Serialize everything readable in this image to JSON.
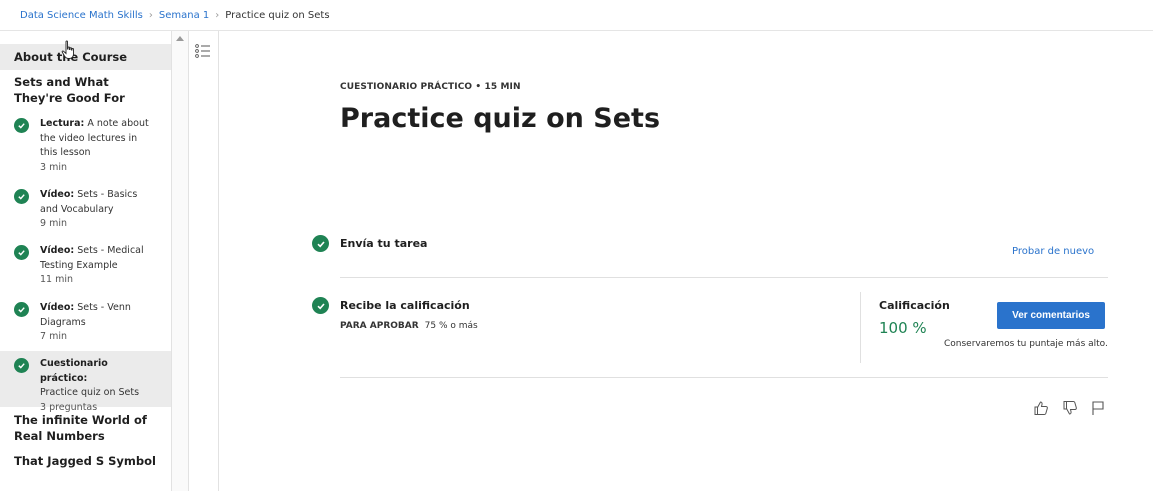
{
  "breadcrumb": {
    "course": "Data Science Math Skills",
    "week": "Semana 1",
    "current": "Practice quiz on Sets"
  },
  "sidebar": {
    "about": "About the Course",
    "module": "Sets and What They're Good For",
    "items": [
      {
        "type": "Lectura:",
        "title": "A note about the video lectures in this lesson",
        "meta": "3 min"
      },
      {
        "type": "Vídeo:",
        "title": "Sets - Basics and Vocabulary",
        "meta": "9 min"
      },
      {
        "type": "Vídeo:",
        "title": "Sets - Medical Testing Example",
        "meta": "11 min"
      },
      {
        "type": "Vídeo:",
        "title": "Sets - Venn Diagrams",
        "meta": "7 min"
      },
      {
        "type": "Cuestionario práctico:",
        "title": "Practice quiz on Sets",
        "meta": "3 preguntas"
      }
    ],
    "next_modules": [
      "The infinite World of Real Numbers",
      "That Jagged S Symbol"
    ]
  },
  "main": {
    "kicker": "CUESTIONARIO PRÁCTICO • 15 MIN",
    "title": "Practice quiz on Sets",
    "submit_label": "Envía tu tarea",
    "retry": "Probar de nuevo",
    "receive_label": "Recibe la calificación",
    "pass_key": "PARA APROBAR",
    "pass_value": "75 % o más",
    "grade_label": "Calificación",
    "grade_value": "100 %",
    "feedback_button": "Ver comentarios",
    "keep_note": "Conservaremos tu puntaje más alto."
  },
  "colors": {
    "accent": "#2a73cc",
    "success": "#1f8354",
    "active_bg": "#ebebeb"
  },
  "icons": [
    "checkmark-icon",
    "list-icon",
    "thumbs-up-icon",
    "thumbs-down-icon",
    "flag-icon",
    "chevron-right-icon",
    "cursor-icon"
  ]
}
